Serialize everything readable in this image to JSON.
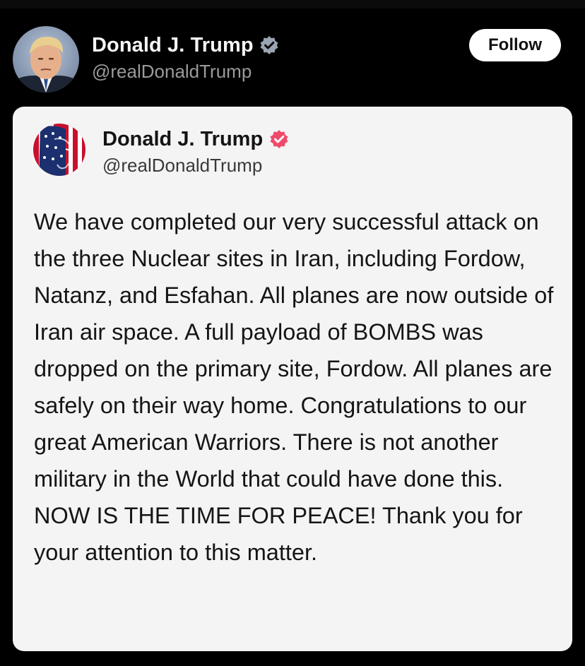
{
  "post": {
    "author_name": "Donald J. Trump",
    "author_handle": "@realDonaldTrump",
    "verified_badge_color": "#9aa4b2",
    "follow_label": "Follow"
  },
  "embedded_post": {
    "author_name": "Donald J. Trump",
    "author_handle": "@realDonaldTrump",
    "verified_badge_color": "#f04a6a",
    "text": "We have completed our very successful attack on the three Nuclear sites in Iran, including Fordow, Natanz, and Esfahan. All planes are now outside of Iran air space. A full payload of BOMBS was dropped on the primary site, Fordow. All planes are safely on their way home. Congratulations to our great American Warriors. There is not another military in the World that could have done this. NOW IS THE TIME FOR PEACE! Thank you for your attention to this matter."
  },
  "colors": {
    "background": "#000000",
    "card_background": "#f4f4f4",
    "follow_button": "#ffffff"
  }
}
